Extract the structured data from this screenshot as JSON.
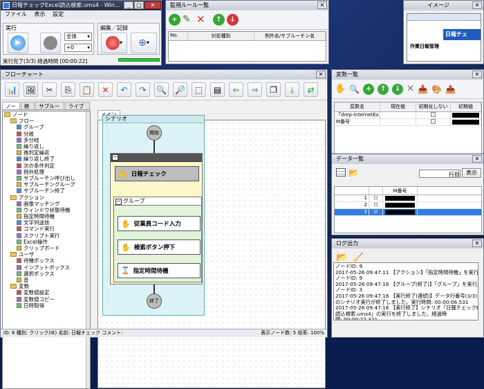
{
  "main_window": {
    "title": "日報チェックExcel読込検索.ums4 - Win...",
    "menu": [
      "ファイル",
      "表示",
      "設定"
    ],
    "exec_label": "実行",
    "edit_label": "編集／記録",
    "scope_select": "全体",
    "speed_select": "+0",
    "status": "実行完了(3/3) 経過時間 [00:00:22]"
  },
  "monitor_window": {
    "title": "監視ルール一覧",
    "columns": [
      "No.",
      "対処種別",
      "例外名/サブルーチン名"
    ]
  },
  "image_window": {
    "title": "イメージ",
    "preview_text1": "日報チェ",
    "preview_text2": "作業日報管理"
  },
  "flowchart_window": {
    "title": "フローチャート",
    "tabs": [
      "ノード",
      "検索",
      "サブルーチン",
      "ライブラリ"
    ],
    "canvas_tab": "メイン",
    "tree": [
      {
        "label": "ノード",
        "level": 0,
        "kind": "folder"
      },
      {
        "label": "フロー",
        "level": 1,
        "kind": "folder"
      },
      {
        "label": "グループ",
        "level": 2,
        "kind": "item"
      },
      {
        "label": "分岐",
        "level": 2,
        "kind": "item"
      },
      {
        "label": "多分岐",
        "level": 2,
        "kind": "item"
      },
      {
        "label": "繰り返し",
        "level": 2,
        "kind": "item"
      },
      {
        "label": "後判定繰返",
        "level": 2,
        "kind": "item"
      },
      {
        "label": "繰り返し終了",
        "level": 2,
        "kind": "item"
      },
      {
        "label": "次の条件判定",
        "level": 2,
        "kind": "item"
      },
      {
        "label": "例外処理",
        "level": 2,
        "kind": "item"
      },
      {
        "label": "サブルーチン呼び出し",
        "level": 2,
        "kind": "item"
      },
      {
        "label": "サブルーチングループ",
        "level": 2,
        "kind": "item"
      },
      {
        "label": "サブルーチン終了",
        "level": 2,
        "kind": "item"
      },
      {
        "label": "アクション",
        "level": 1,
        "kind": "folder"
      },
      {
        "label": "画像マッチング",
        "level": 2,
        "kind": "item"
      },
      {
        "label": "ウィンドウ状態待機",
        "level": 2,
        "kind": "item"
      },
      {
        "label": "指定時間待機",
        "level": 2,
        "kind": "item"
      },
      {
        "label": "文字列送信",
        "level": 2,
        "kind": "item"
      },
      {
        "label": "コマンド実行",
        "level": 2,
        "kind": "item"
      },
      {
        "label": "スクリプト実行",
        "level": 2,
        "kind": "item"
      },
      {
        "label": "Excel操作",
        "level": 2,
        "kind": "item"
      },
      {
        "label": "クリップボード",
        "level": 2,
        "kind": "item"
      },
      {
        "label": "ユーザ",
        "level": 1,
        "kind": "folder"
      },
      {
        "label": "待機ボックス",
        "level": 2,
        "kind": "item"
      },
      {
        "label": "インプットボックス",
        "level": 2,
        "kind": "item"
      },
      {
        "label": "選択ボックス",
        "level": 2,
        "kind": "item"
      },
      {
        "label": "音",
        "level": 2,
        "kind": "item"
      },
      {
        "label": "変数",
        "level": 1,
        "kind": "folder"
      },
      {
        "label": "変数値設定",
        "level": 2,
        "kind": "item"
      },
      {
        "label": "変数値コピー",
        "level": 2,
        "kind": "item"
      },
      {
        "label": "日時取得",
        "level": 2,
        "kind": "item"
      }
    ],
    "scenario_label": "シナリオ",
    "start_label": "開始",
    "end_label": "終了",
    "group_label": "グループ",
    "nodes": [
      "日報チェック",
      "従業員コード入力",
      "検索ボタン押下",
      "指定時間待機"
    ],
    "status": "ID: 6 種別: クリック(IE) 名前: 日報チェック コメント:",
    "status_right": "表示ノード数: 5 倍率: 100%"
  },
  "variables_window": {
    "title": "変数一覧",
    "columns": [
      "変数名",
      "現在値",
      "初期化しない",
      "初期値"
    ],
    "rows": [
      {
        "name": "「drep-InternetEx..."
      },
      {
        "name": "M番号"
      }
    ]
  },
  "data_window": {
    "title": "データ一覧",
    "row_suffix": "行目",
    "show_button": "表示",
    "column": "M番号",
    "rows": [
      "1",
      "2",
      "3"
    ]
  },
  "log_window": {
    "title": "ログ出力",
    "lines": [
      "ノードID: 9",
      "2017-05-26 09:47:11 【アクション】「指定時間待機」を実行。",
      "ノードID: 9",
      "2017-05-26 09:47:16 【グループ(終了)】「グループ」を実行。",
      "ノードID: 3",
      "2017-05-26 09:47:16 【実行終了(連続)】データ行番号(3/3)",
      "のシナリオ実行が終了しました。実行時間: 00:00:06.531",
      "2017-05-26 09:47:16 【実行終了】シナリオ「日報チェックExcel",
      "読込検索.ums4」の実行を終了しました。経過時",
      "間: 00:00:22.321"
    ]
  }
}
